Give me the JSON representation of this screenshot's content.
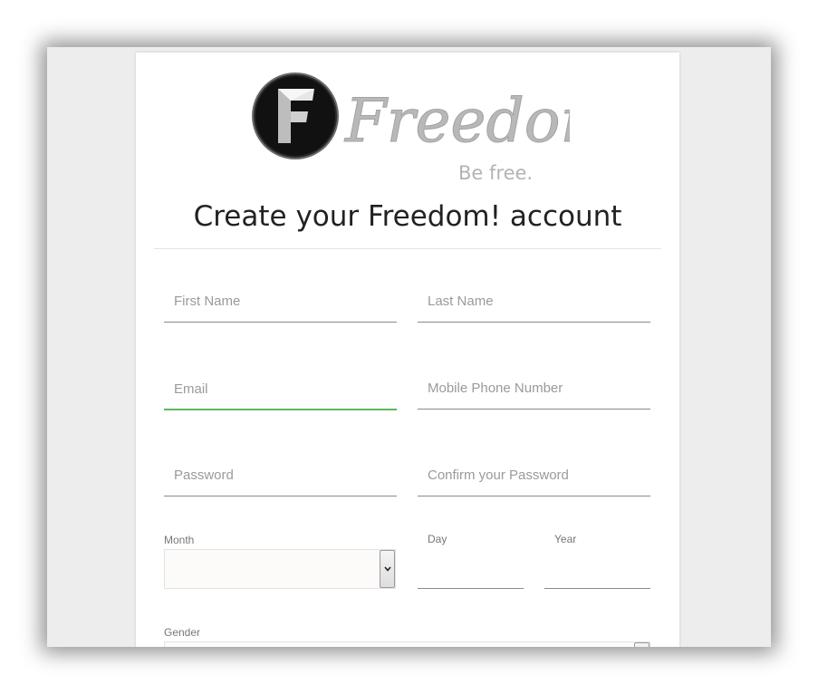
{
  "brand": {
    "badge_letter": "F",
    "wordmark": "Freedom!",
    "tagline": "Be free."
  },
  "page": {
    "title": "Create your Freedom! account"
  },
  "form": {
    "first_name_placeholder": "First Name",
    "last_name_placeholder": "Last Name",
    "email_placeholder": "Email",
    "phone_placeholder": "Mobile Phone Number",
    "password_placeholder": "Password",
    "confirm_password_placeholder": "Confirm your Password",
    "month_label": "Month",
    "day_label": "Day",
    "year_label": "Year",
    "gender_label": "Gender"
  },
  "colors": {
    "focus_accent": "#5cb85c",
    "badge_fill": "#111111",
    "wordmark_color": "#b8b8b8"
  }
}
